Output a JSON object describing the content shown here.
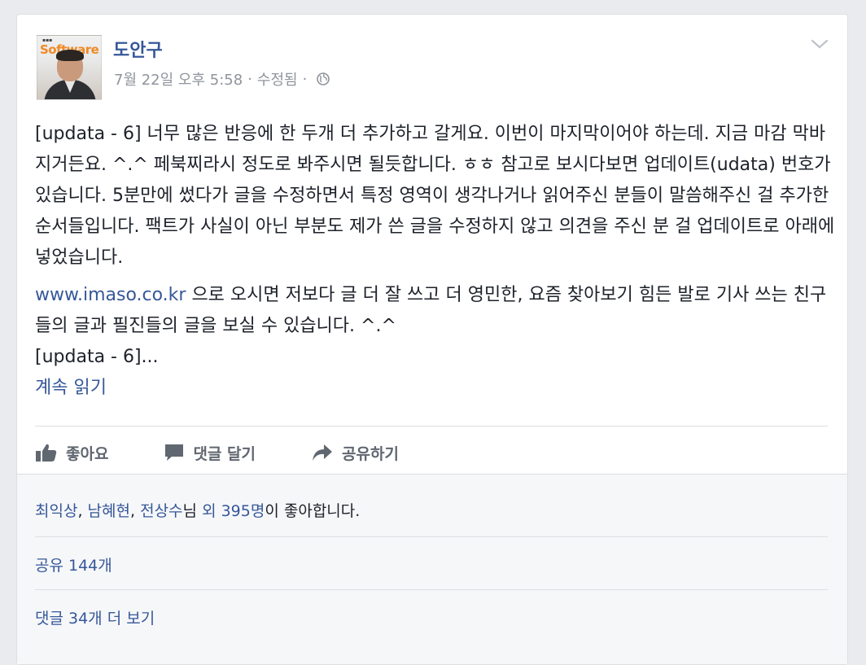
{
  "post": {
    "author": "도안구",
    "avatar_logo": "Software",
    "timestamp": "7월 22일 오후 5:58",
    "edited": "수정됨",
    "separator": "·",
    "paragraph1": "[updata - 6] 너무 많은 반응에 한 두개 더 추가하고 갈게요. 이번이 마지막이어야 하는데. 지금 마감 막바지거든요. ^.^ 페북찌라시 정도로 봐주시면 될듯합니다. ㅎㅎ 참고로 보시다보면 업데이트(udata) 번호가 있습니다. 5분만에 썼다가 글을 수정하면서 특정 영역이 생각나거나 읽어주신 분들이 말씀해주신 걸 추가한 순서들입니다. 팩트가 사실이 아닌 부분도 제가 쓴 글을 수정하지 않고 의견을 주신 분 걸 업데이트로 아래에 넣었습니다.",
    "link_text": "www.imaso.co.kr",
    "paragraph2_rest": " 으로 오시면 저보다 글 더 잘 쓰고 더 영민한, 요즘 찾아보기 힘든 발로 기사 쓰는 친구들의 글과 필진들의 글을 보실 수 있습니다. ^.^",
    "truncated": "[updata - 6]...",
    "see_more": "계속 읽기"
  },
  "actions": {
    "like": "좋아요",
    "comment": "댓글 달기",
    "share": "공유하기"
  },
  "footer": {
    "liker1": "최익상",
    "liker2": "남혜현",
    "liker3": "전상수",
    "likers_suffix_nim": "님",
    "others": "외 395명",
    "likes_suffix": "이 좋아합니다.",
    "comma": ",",
    "shares": "공유 144개",
    "more_comments": "댓글 34개 더 보기"
  },
  "colors": {
    "link": "#365899",
    "text": "#1d2129",
    "meta": "#90949c",
    "action": "#606770",
    "footer_bg": "#f6f7f9"
  },
  "icons": [
    "globe-icon",
    "chevron-down-icon",
    "thumbs-up-icon",
    "comment-icon",
    "share-icon"
  ]
}
